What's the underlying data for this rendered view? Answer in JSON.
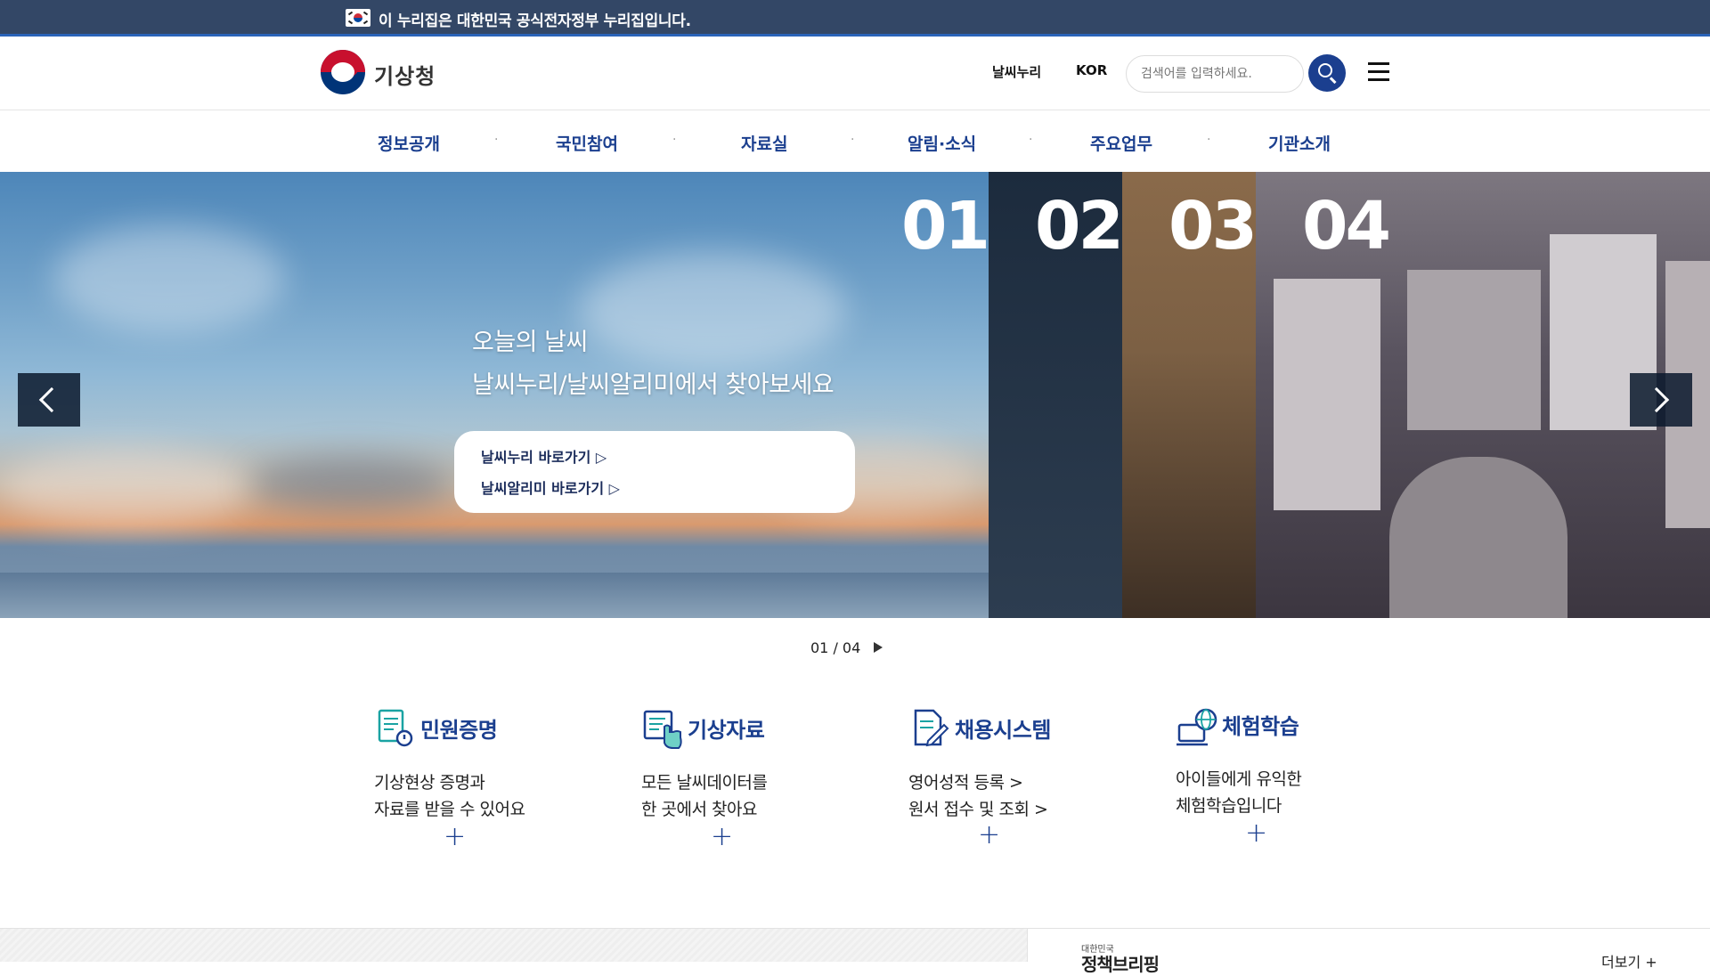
{
  "gov_banner": {
    "text": "이 누리집은 대한민국 공식전자정부 누리집입니다."
  },
  "header": {
    "logo_text": "기상청",
    "util_links": [
      "날씨누리",
      "KOR"
    ],
    "search_placeholder": "검색어를 입력하세요."
  },
  "gnb": {
    "items": [
      "정보공개",
      "국민참여",
      "자료실",
      "알림·소식",
      "주요업무",
      "기관소개"
    ]
  },
  "hero": {
    "title_line1": "오늘의 날씨",
    "title_line2": "날씨누리/날씨알리미에서 찾아보세요",
    "links": [
      "날씨누리 바로가기 ▷",
      "날씨알리미 바로가기 ▷"
    ],
    "slide_numbers": [
      "01",
      "02",
      "03",
      "04"
    ],
    "pager": "01 / 04"
  },
  "quick": [
    {
      "title": "민원증명",
      "desc1": "기상현상 증명과",
      "desc2": "자료를 받을 수 있어요",
      "plus": "+",
      "icon": "document-alert-icon"
    },
    {
      "title": "기상자료",
      "desc1": "모든 날씨데이터를",
      "desc2": "한 곳에서 찾아요",
      "plus": "+",
      "icon": "data-touch-icon"
    },
    {
      "title": "채용시스템",
      "desc1": "영어성적 등록  >",
      "desc2": "원서 접수 및 조회  >",
      "plus": "+",
      "icon": "document-edit-icon"
    },
    {
      "title": "체험학습",
      "desc1": "아이들에게 유익한",
      "desc2": "체험학습입니다",
      "plus": "+",
      "icon": "globe-laptop-icon"
    }
  ],
  "bottom": {
    "policy_small": "대한민국",
    "policy_big": "정책브리핑",
    "more": "더보기 +"
  },
  "colors": {
    "gov_bar": "#334766",
    "brand_blue": "#1b3f8f"
  }
}
